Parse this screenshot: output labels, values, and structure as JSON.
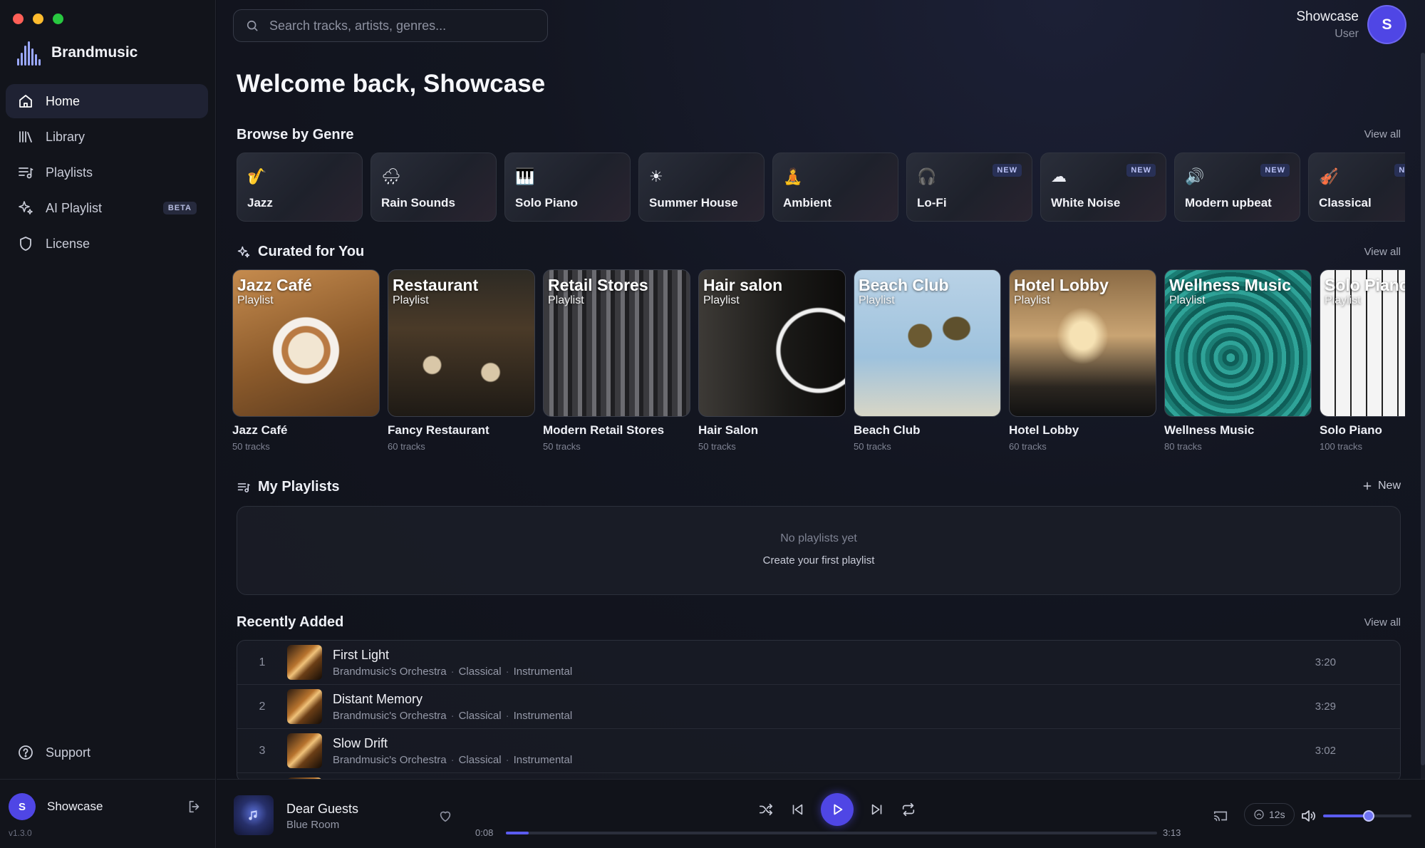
{
  "colors": {
    "accent": "#4f46e5",
    "background": "#0f1118",
    "sidebar": "#12141b"
  },
  "window": {
    "controls": [
      "#ff5f57",
      "#febc2e",
      "#28c840"
    ]
  },
  "brand": {
    "name": "Brandmusic"
  },
  "nav": {
    "items": [
      {
        "label": "Home",
        "icon": "home-icon",
        "active": true
      },
      {
        "label": "Library",
        "icon": "library-icon"
      },
      {
        "label": "Playlists",
        "icon": "playlist-icon"
      },
      {
        "label": "AI Playlist",
        "icon": "sparkle-icon",
        "badge": "BETA"
      },
      {
        "label": "License",
        "icon": "shield-icon"
      }
    ],
    "support": "Support"
  },
  "sidebar_user": {
    "initial": "S",
    "name": "Showcase",
    "version": "v1.3.0"
  },
  "search": {
    "placeholder": "Search tracks, artists, genres..."
  },
  "header_user": {
    "name": "Showcase",
    "role": "User",
    "initial": "S"
  },
  "welcome": "Welcome back, Showcase",
  "genres": {
    "title": "Browse by Genre",
    "view_all": "View all",
    "items": [
      {
        "label": "Jazz",
        "icon": "🎷"
      },
      {
        "label": "Rain Sounds",
        "icon": "🌧"
      },
      {
        "label": "Solo Piano",
        "icon": "🎹"
      },
      {
        "label": "Summer House",
        "icon": "☀"
      },
      {
        "label": "Ambient",
        "icon": "🧘"
      },
      {
        "label": "Lo-Fi",
        "icon": "🎧",
        "badge": "NEW"
      },
      {
        "label": "White Noise",
        "icon": "☁",
        "badge": "NEW"
      },
      {
        "label": "Modern upbeat",
        "icon": "🔊",
        "badge": "NEW"
      },
      {
        "label": "Classical",
        "icon": "🎻",
        "badge": "NEW"
      }
    ]
  },
  "curated": {
    "title": "Curated for You",
    "view_all": "View all",
    "items": [
      {
        "overlay": "Jazz Café",
        "sub": "Playlist",
        "name": "Jazz Café",
        "count": "50 tracks"
      },
      {
        "overlay": "Restaurant",
        "sub": "Playlist",
        "name": "Fancy Restaurant",
        "count": "60 tracks"
      },
      {
        "overlay": "Retail Stores",
        "sub": "Playlist",
        "name": "Modern Retail Stores",
        "count": "50 tracks"
      },
      {
        "overlay": "Hair salon",
        "sub": "Playlist",
        "name": "Hair Salon",
        "count": "50 tracks"
      },
      {
        "overlay": "Beach Club",
        "sub": "Playlist",
        "name": "Beach Club",
        "count": "50 tracks"
      },
      {
        "overlay": "Hotel Lobby",
        "sub": "Playlist",
        "name": "Hotel Lobby",
        "count": "60 tracks"
      },
      {
        "overlay": "Wellness Music",
        "sub": "Playlist",
        "name": "Wellness Music",
        "count": "80 tracks"
      },
      {
        "overlay": "Solo Piano",
        "sub": "Playlist",
        "name": "Solo Piano",
        "count": "100 tracks"
      }
    ]
  },
  "my_playlists": {
    "title": "My Playlists",
    "new_label": "New",
    "empty_title": "No playlists yet",
    "empty_action": "Create your first playlist"
  },
  "recent": {
    "title": "Recently Added",
    "view_all": "View all",
    "tracks": [
      {
        "num": "1",
        "title": "First Light",
        "artist": "Brandmusic's Orchestra",
        "genre": "Classical",
        "type": "Instrumental",
        "duration": "3:20"
      },
      {
        "num": "2",
        "title": "Distant Memory",
        "artist": "Brandmusic's Orchestra",
        "genre": "Classical",
        "type": "Instrumental",
        "duration": "3:29"
      },
      {
        "num": "3",
        "title": "Slow Drift",
        "artist": "Brandmusic's Orchestra",
        "genre": "Classical",
        "type": "Instrumental",
        "duration": "3:02"
      }
    ]
  },
  "player": {
    "title": "Dear Guests",
    "artist": "Blue Room",
    "elapsed": "0:08",
    "total": "3:13",
    "progress_fraction": 0.035,
    "crossfade": "12s",
    "volume_fraction": 0.52
  }
}
